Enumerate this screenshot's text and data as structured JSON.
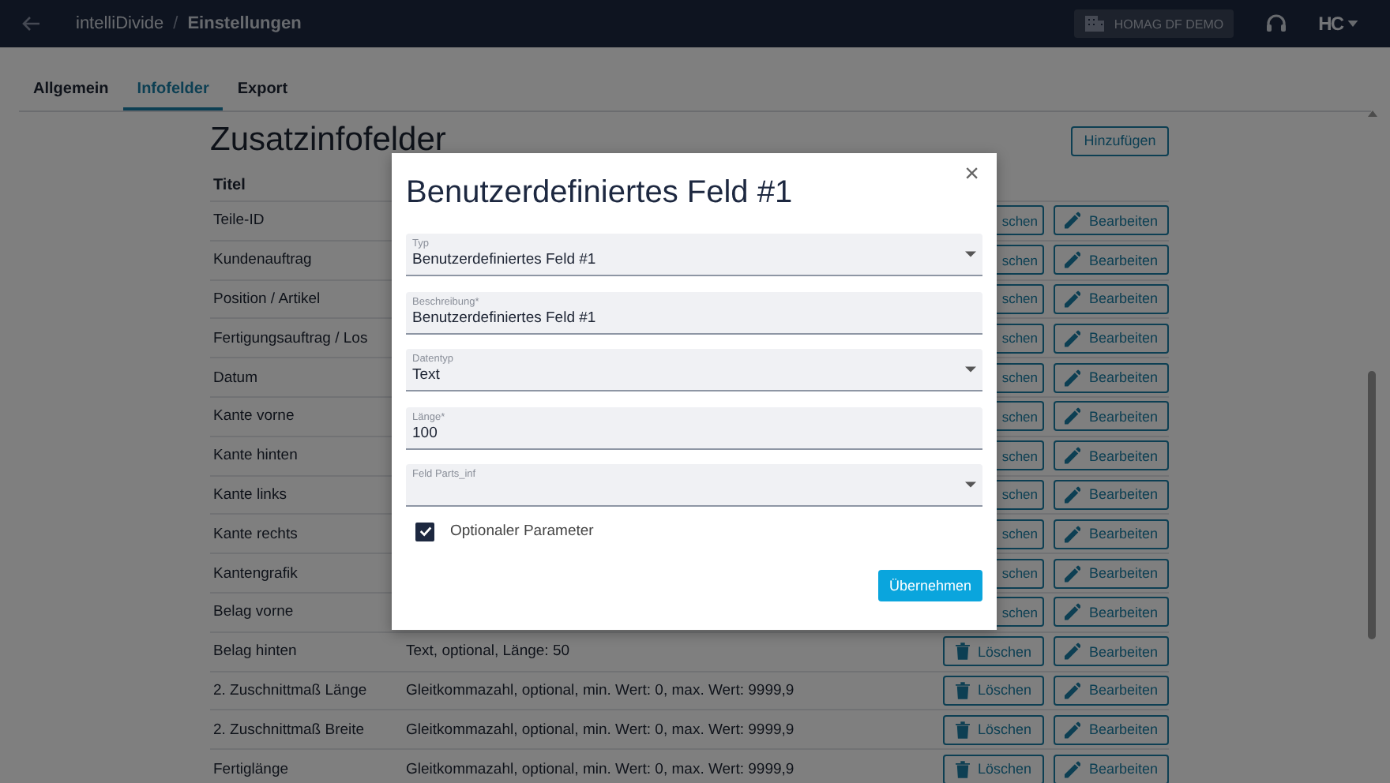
{
  "header": {
    "app": "intelliDivide",
    "separator": "/",
    "page": "Einstellungen",
    "company": "HOMAG DF DEMO",
    "logo": "HC"
  },
  "tabs": [
    {
      "label": "Allgemein",
      "selected": false
    },
    {
      "label": "Infofelder",
      "selected": true
    },
    {
      "label": "Export",
      "selected": false
    }
  ],
  "section": {
    "title": "Zusatzinfofelder",
    "add_button": "Hinzufügen",
    "column_title": "Titel"
  },
  "rows": [
    {
      "title": "Teile-ID",
      "delete": "schen",
      "covered": true,
      "edit": "Bearbeiten"
    },
    {
      "title": "Kundenauftrag",
      "delete": "schen",
      "covered": true,
      "edit": "Bearbeiten"
    },
    {
      "title": "Position / Artikel",
      "delete": "schen",
      "covered": true,
      "edit": "Bearbeiten"
    },
    {
      "title": "Fertigungsauftrag / Los",
      "delete": "schen",
      "covered": true,
      "edit": "Bearbeiten"
    },
    {
      "title": "Datum",
      "delete": "schen",
      "covered": true,
      "edit": "Bearbeiten"
    },
    {
      "title": "Kante vorne",
      "delete": "schen",
      "covered": true,
      "edit": "Bearbeiten"
    },
    {
      "title": "Kante hinten",
      "delete": "schen",
      "covered": true,
      "edit": "Bearbeiten"
    },
    {
      "title": "Kante links",
      "delete": "schen",
      "covered": true,
      "edit": "Bearbeiten"
    },
    {
      "title": "Kante rechts",
      "delete": "schen",
      "covered": true,
      "edit": "Bearbeiten"
    },
    {
      "title": "Kantengrafik",
      "delete": "schen",
      "covered": true,
      "edit": "Bearbeiten"
    },
    {
      "title": "Belag vorne",
      "delete": "schen",
      "covered": true,
      "edit": "Bearbeiten"
    },
    {
      "title": "Belag hinten",
      "description": "Text, optional, Länge: 50",
      "delete": "Löschen",
      "covered": false,
      "edit": "Bearbeiten"
    },
    {
      "title": "2. Zuschnittmaß Länge",
      "description": "Gleitkommazahl, optional, min. Wert: 0, max. Wert: 9999,9",
      "delete": "Löschen",
      "covered": false,
      "edit": "Bearbeiten"
    },
    {
      "title": "2. Zuschnittmaß Breite",
      "description": "Gleitkommazahl, optional, min. Wert: 0, max. Wert: 9999,9",
      "delete": "Löschen",
      "covered": false,
      "edit": "Bearbeiten"
    },
    {
      "title": "Fertiglänge",
      "description": "Gleitkommazahl, optional, min. Wert: 0, max. Wert: 9999,9",
      "delete": "Löschen",
      "covered": false,
      "edit": "Bearbeiten"
    }
  ],
  "dialog": {
    "title": "Benutzerdefiniertes Feld #1",
    "close": "×",
    "fields": [
      {
        "kind": "select",
        "label": "Typ",
        "value": "Benutzerdefiniertes Feld #1"
      },
      {
        "kind": "input",
        "label": "Beschreibung*",
        "value": "Benutzerdefiniertes Feld #1"
      },
      {
        "kind": "select",
        "label": "Datentyp",
        "value": "Text"
      },
      {
        "kind": "input",
        "label": "Länge*",
        "value": "100"
      },
      {
        "kind": "select",
        "label": "Feld Parts_inf"
      }
    ],
    "checkbox": {
      "label": "Optionaler Parameter",
      "checked": true
    },
    "submit": "Übernehmen"
  }
}
